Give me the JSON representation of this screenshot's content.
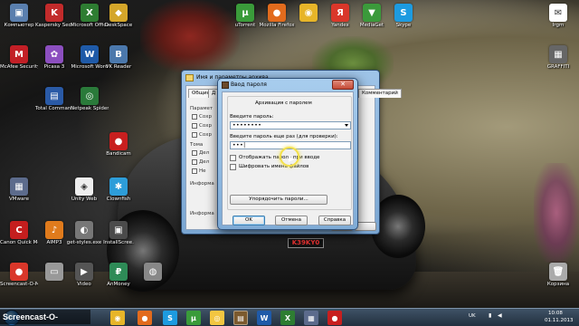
{
  "desktop": {
    "icons": [
      {
        "label": "Компьютер",
        "glyph": "▣",
        "color": "#5a7fae"
      },
      {
        "label": "Kaspersky Security Sc.",
        "glyph": "K",
        "color": "#c22b2b"
      },
      {
        "label": "Microsoft Office Exc.",
        "glyph": "X",
        "color": "#2e7d32"
      },
      {
        "label": "DeskSpace",
        "glyph": "◆",
        "color": "#d4a62a"
      },
      {
        "label": "uTorrent",
        "glyph": "µ",
        "color": "#3a9b3a"
      },
      {
        "label": "Mozilla Firefox",
        "glyph": "●",
        "color": "#e26b1d"
      },
      {
        "label": "",
        "glyph": "◉",
        "color": "#e7b529"
      },
      {
        "label": "Yandex",
        "glyph": "Я",
        "color": "#d9372a"
      },
      {
        "label": "MediaGet",
        "glyph": "▼",
        "color": "#3b9a3b"
      },
      {
        "label": "Skype",
        "glyph": "S",
        "color": "#1d9be0"
      },
      {
        "label": "Irgm",
        "glyph": "✉",
        "color": "#ffffff"
      },
      {
        "label": "McAfee Security Sc.",
        "glyph": "M",
        "color": "#c21f26"
      },
      {
        "label": "Picasa 3",
        "glyph": "✿",
        "color": "#8c4fbf"
      },
      {
        "label": "Total Commander",
        "glyph": "▤",
        "color": "#2a5aa6"
      },
      {
        "label": "Microsoft Word",
        "glyph": "W",
        "color": "#1f5aa8"
      },
      {
        "label": "VK Reader",
        "glyph": "В",
        "color": "#4b78ac"
      },
      {
        "label": "Netpeak Spider",
        "glyph": "◎",
        "color": "#2a7a3a"
      },
      {
        "label": "Bandicam",
        "glyph": "●",
        "color": "#c81f1f"
      },
      {
        "label": "VMware",
        "glyph": "▦",
        "color": "#5c6b8c"
      },
      {
        "label": "Unity Web",
        "glyph": "◈",
        "color": "#eeeeee"
      },
      {
        "label": "Clownfish",
        "glyph": "✱",
        "color": "#2d9dd9"
      },
      {
        "label": "Canon Quick Menu",
        "glyph": "C",
        "color": "#c41e1e"
      },
      {
        "label": "AIMP3",
        "glyph": "♪",
        "color": "#e07b1c"
      },
      {
        "label": "get-styles.exe",
        "glyph": "◐",
        "color": "#777777"
      },
      {
        "label": "InstallScree.",
        "glyph": "▣",
        "color": "#4b4b4b"
      },
      {
        "label": "Screencast-O-Matic",
        "glyph": "●",
        "color": "#d9372a"
      },
      {
        "label": "",
        "glyph": "▭",
        "color": "#999999"
      },
      {
        "label": "Video",
        "glyph": "▶",
        "color": "#555555"
      },
      {
        "label": "AnMoney",
        "glyph": "₽",
        "color": "#2e8b57"
      },
      {
        "label": "",
        "glyph": "◍",
        "color": "#888888"
      },
      {
        "label": "GRAFFITI",
        "glyph": "▦",
        "color": "#666666"
      },
      {
        "label": "Корзина",
        "glyph": "🗑",
        "color": "#aaaaaa"
      }
    ]
  },
  "wallpaper": {
    "plate_text": "K39KY0"
  },
  "bg_window": {
    "title": "Имя и параметры архива",
    "tabs": [
      "Общие",
      "Д",
      "",
      "",
      "",
      "",
      "",
      "",
      "",
      "",
      "",
      "рхивы",
      "Комментарий"
    ],
    "groups": [
      "Парамет",
      "Тома",
      "Информа",
      "Информа"
    ],
    "checkbox_labels": [
      "Сохр",
      "Сохр",
      "Сохр",
      "Дел",
      "Дел",
      "Не"
    ]
  },
  "dialog": {
    "title": "Ввод пароля",
    "close_glyph": "✕",
    "heading": "Архивация с паролем",
    "password_label": "Введите пароль:",
    "password_value": "••••••••",
    "confirm_label": "Введите пароль еще раз (для проверки):",
    "confirm_value": "•••|",
    "show_password_label": "Отображать пароль при вводе",
    "encrypt_names_label": "Шифровать имена файлов",
    "organize_button": "Упорядочить пароли...",
    "ok_button": "OK",
    "cancel_button": "Отмена",
    "help_button": "Справка"
  },
  "taskbar": {
    "watermark": "Screencast-O-Matic.com",
    "apps": [
      {
        "glyph": "◉",
        "color": "#e7b529"
      },
      {
        "glyph": "●",
        "color": "#e26b1d"
      },
      {
        "glyph": "S",
        "color": "#1d9be0"
      },
      {
        "glyph": "µ",
        "color": "#3a9b3a"
      },
      {
        "glyph": "◎",
        "color": "#f2c641"
      },
      {
        "glyph": "▤",
        "color": "#7c5a2e"
      },
      {
        "glyph": "W",
        "color": "#1f5aa8"
      },
      {
        "glyph": "X",
        "color": "#2e7d32"
      },
      {
        "glyph": "▦",
        "color": "#5c6b8c"
      },
      {
        "glyph": "●",
        "color": "#c81f1f"
      }
    ],
    "language": "UK",
    "time": "10:08",
    "date": "01.11.2013"
  },
  "colors": {
    "window_frame": "#7fabd6",
    "client_bg": "#f0f0f0",
    "taskbar": "#22303f",
    "cursor_ring": "#f3e04a"
  }
}
